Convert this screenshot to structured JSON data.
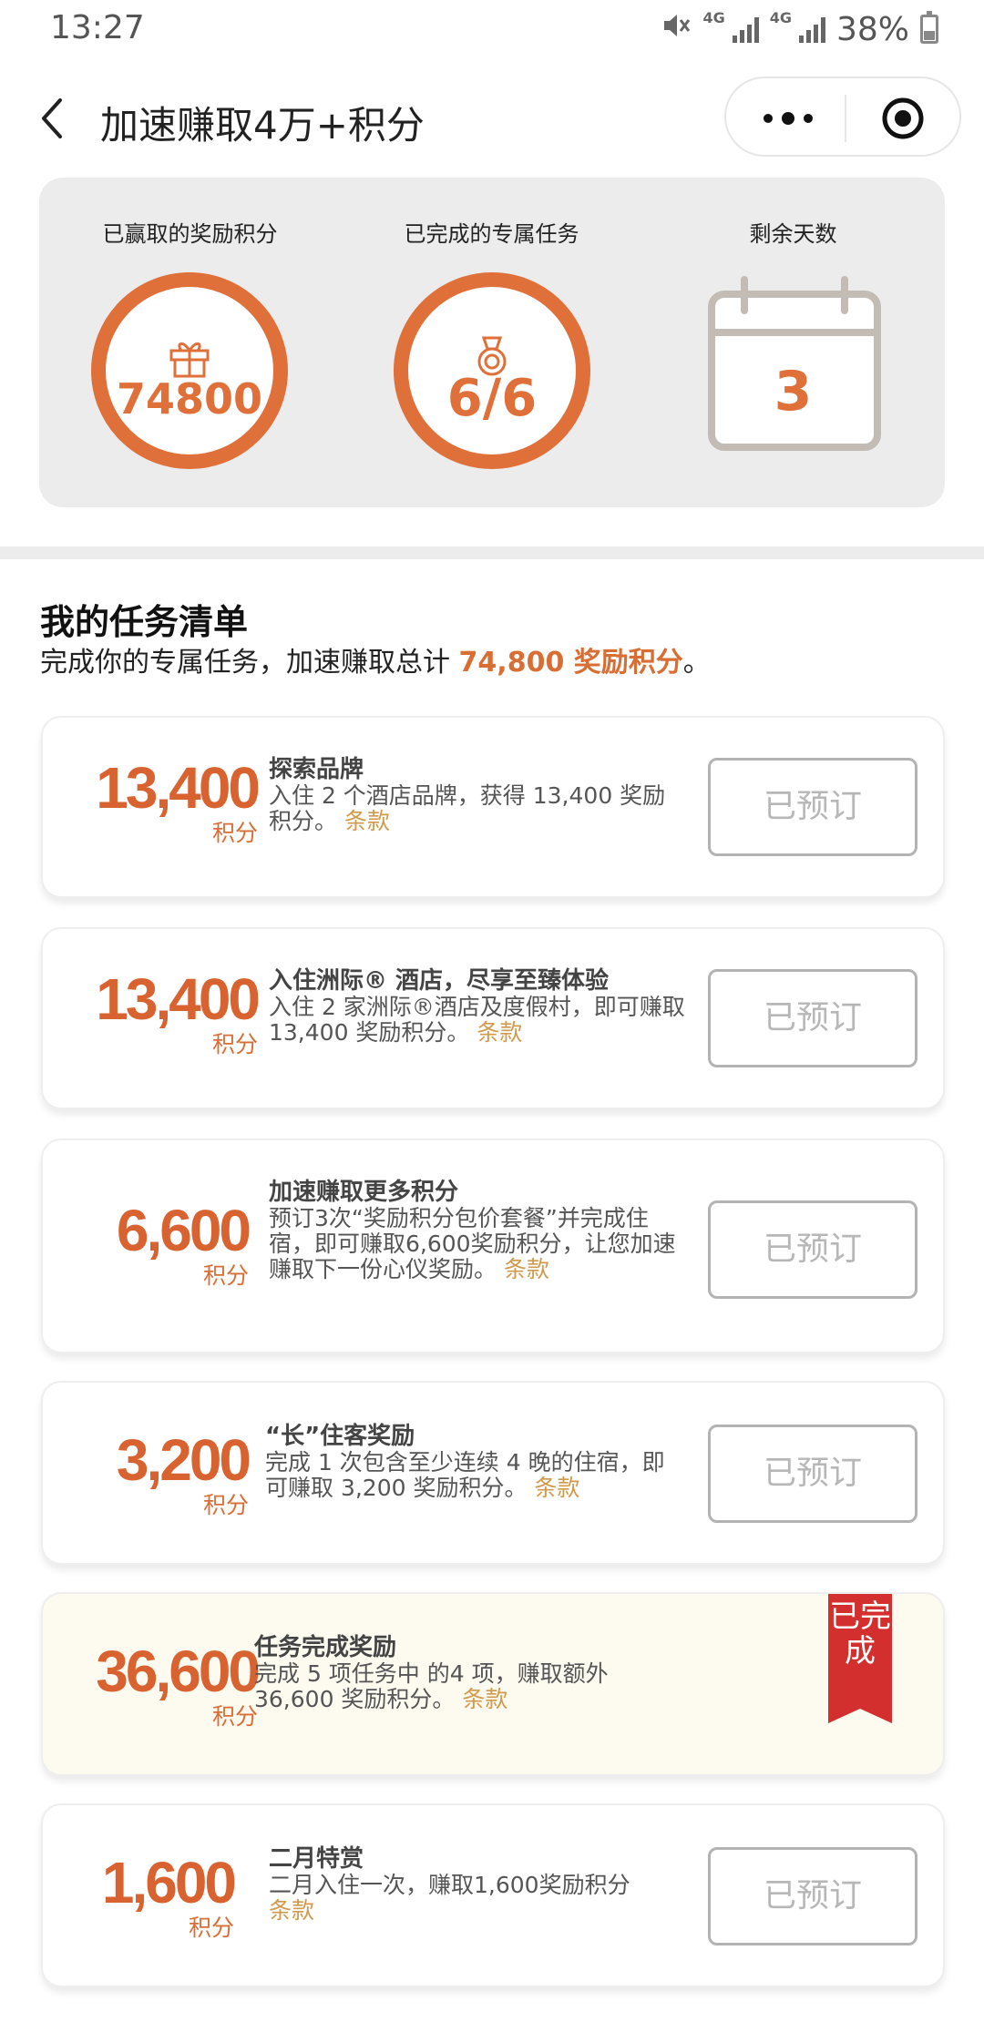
{
  "status_bar": {
    "time": "13:27",
    "network_label": "4G",
    "battery": "38%",
    "battery_level": 0.38
  },
  "nav": {
    "title": "加速赚取4万+积分"
  },
  "summary": {
    "earned_label": "已赢取的奖励积分",
    "earned_value": "74800",
    "completed_label": "已完成的专属任务",
    "completed_value": "6/6",
    "days_label": "剩余天数",
    "days_value": "3"
  },
  "list": {
    "title": "我的任务清单",
    "subtitle_prefix": "完成你的专属任务，加速赚取总计 ",
    "subtitle_highlight": "74,800 奖励积分",
    "subtitle_suffix": "。"
  },
  "points_unit": "积分",
  "terms_label": "条款",
  "booked_label": "已预订",
  "completed_badge": "已完成",
  "tasks": [
    {
      "points": "13,400",
      "title": "探索品牌",
      "desc": "入住 2 个酒店品牌，获得 13,400 奖励积分。",
      "status": "booked"
    },
    {
      "points": "13,400",
      "title": "入住洲际® 酒店，尽享至臻体验",
      "desc": "入住 2 家洲际®酒店及度假村，即可赚取 13,400 奖励积分。",
      "status": "booked"
    },
    {
      "points": "6,600",
      "title": "加速赚取更多积分",
      "desc": "预订3次“奖励积分包价套餐”并完成住宿，即可赚取6,600奖励积分，让您加速赚取下一份心仪奖励。",
      "status": "booked"
    },
    {
      "points": "3,200",
      "title": "“长”住客奖励",
      "desc": "完成 1 次包含至少连续 4 晚的住宿，即可赚取 3,200 奖励积分。",
      "status": "booked"
    },
    {
      "points": "36,600",
      "title": "任务完成奖励",
      "desc": "完成 5 项任务中 的4 项，赚取额外 36,600 奖励积分。",
      "status": "completed"
    },
    {
      "points": "1,600",
      "title": "二月特赏",
      "desc": "二月入住一次，赚取1,600奖励积分",
      "status": "booked"
    }
  ],
  "colors": {
    "accent": "#e0703a",
    "points": "#d96330",
    "terms": "#d09a4a",
    "ribbon": "#d42f2f",
    "summary_bg": "#ececec"
  }
}
